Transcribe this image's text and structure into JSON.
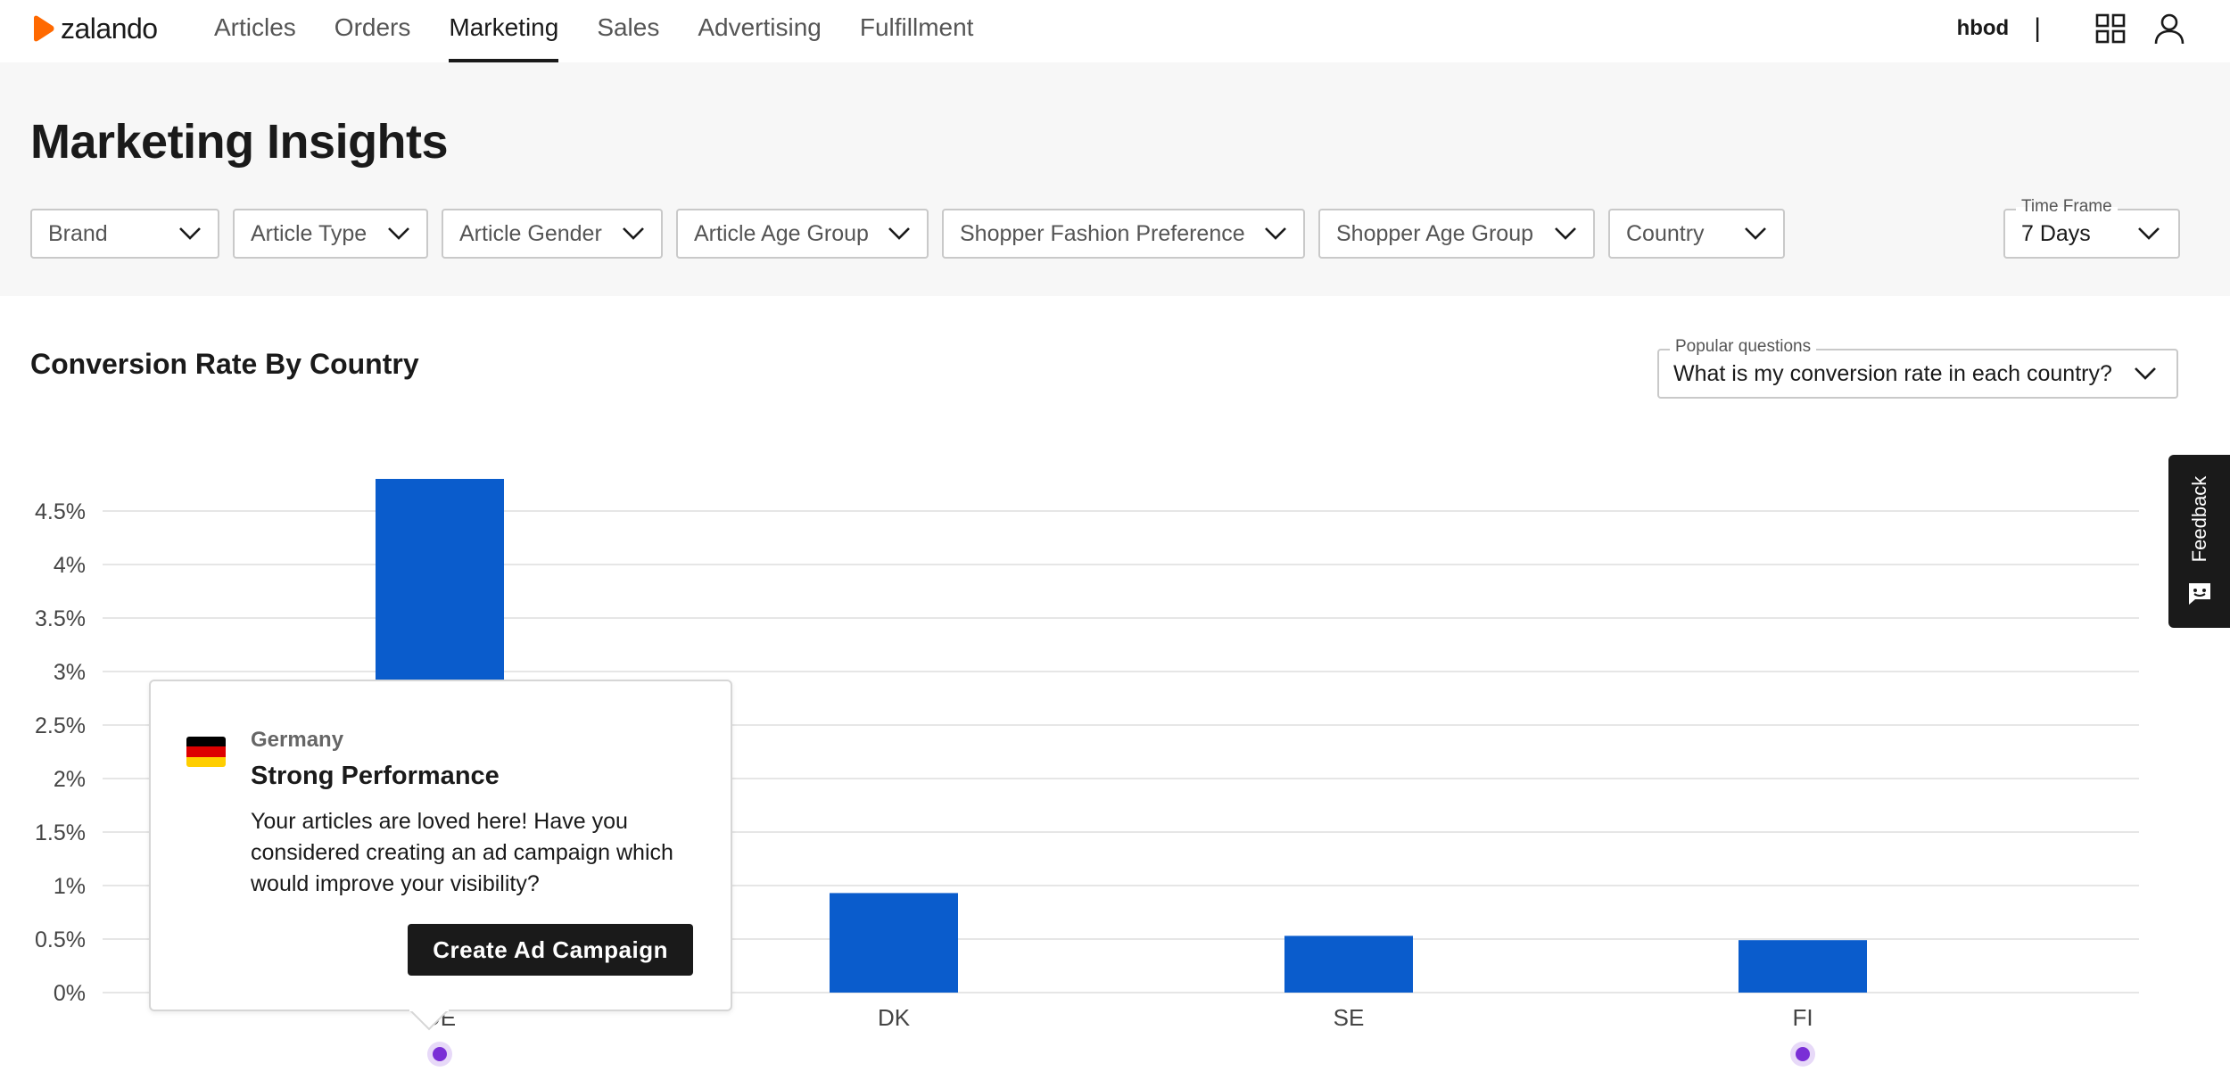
{
  "brand": {
    "name": "zalando",
    "logo_color": "#ff6900"
  },
  "nav": {
    "items": [
      {
        "label": "Articles",
        "active": false
      },
      {
        "label": "Orders",
        "active": false
      },
      {
        "label": "Marketing",
        "active": true
      },
      {
        "label": "Sales",
        "active": false
      },
      {
        "label": "Advertising",
        "active": false
      },
      {
        "label": "Fulfillment",
        "active": false
      }
    ]
  },
  "user": {
    "name": "hbod",
    "separator": "|",
    "icons": [
      "apps-grid-icon",
      "user-icon"
    ]
  },
  "header": {
    "title": "Marketing Insights"
  },
  "filters": [
    {
      "label": "Brand"
    },
    {
      "label": "Article Type"
    },
    {
      "label": "Article Gender"
    },
    {
      "label": "Article Age Group"
    },
    {
      "label": "Shopper Fashion Preference"
    },
    {
      "label": "Shopper Age Group"
    },
    {
      "label": "Country"
    }
  ],
  "timeframe": {
    "label": "Time Frame",
    "value": "7 Days"
  },
  "section": {
    "title": "Conversion Rate By Country"
  },
  "popular_questions": {
    "label": "Popular questions",
    "value": "What is my conversion rate in each country?"
  },
  "chart_data": {
    "type": "bar",
    "title": "Conversion Rate By Country",
    "categories": [
      "DE",
      "DK",
      "SE",
      "FI"
    ],
    "values": [
      4.8,
      0.93,
      0.53,
      0.49
    ],
    "value_suffix": "%",
    "yticks": [
      "0%",
      "0.5%",
      "1%",
      "1.5%",
      "2%",
      "2.5%",
      "3%",
      "3.5%",
      "4%",
      "4.5%"
    ],
    "ylim": [
      0,
      4.5
    ],
    "grid": true,
    "bar_color": "#0a5ccc",
    "marker_color": "#7a2fd6",
    "markers_on": [
      "DE",
      "FI"
    ]
  },
  "tooltip": {
    "country": "Germany",
    "heading": "Strong Performance",
    "body": "Your articles are loved here! Have you considered creating an ad campaign which would improve your visibility?",
    "button_label": "Create Ad Campaign",
    "flag_colors": [
      "#000000",
      "#dd0000",
      "#ffce00"
    ]
  },
  "feedback": {
    "label": "Feedback"
  }
}
